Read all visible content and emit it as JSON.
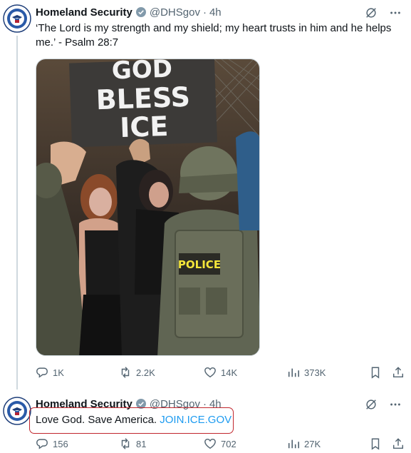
{
  "posts": [
    {
      "author": "Homeland Security",
      "handle": "@DHSgov",
      "time": "4h",
      "text": "‘The Lord is my strength and my shield; my heart trusts in him and he helps me.’ - Psalm 28:7",
      "media": {
        "sign_lines": [
          "GOD",
          "BLESS",
          "ICE"
        ],
        "patch_text": "POLICE"
      },
      "stats": {
        "replies": "1K",
        "reposts": "2.2K",
        "likes": "14K",
        "views": "373K"
      }
    },
    {
      "author": "Homeland Security",
      "handle": "@DHSgov",
      "time": "4h",
      "text": "Love God. Save America. ",
      "link": "JOIN.ICE.GOV",
      "stats": {
        "replies": "156",
        "reposts": "81",
        "likes": "702",
        "views": "27K"
      }
    }
  ],
  "colors": {
    "link": "#1d9bf0",
    "highlight": "#c0262d",
    "verified_badge": "#829aab"
  }
}
